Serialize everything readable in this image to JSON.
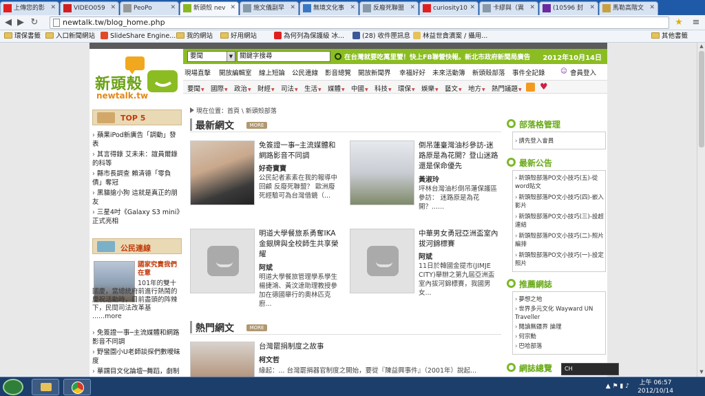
{
  "browser": {
    "tabs": [
      {
        "label": "上傳您的影",
        "color": "#e02020"
      },
      {
        "label": "VIDEO059",
        "color": "#d02020"
      },
      {
        "label": "PeoPo",
        "color": "#999999"
      },
      {
        "label": "新頭殼 nev",
        "color": "#8ab822"
      },
      {
        "label": "施文儀副早",
        "color": "#8899aa"
      },
      {
        "label": "無境文化事",
        "color": "#3b78c4"
      },
      {
        "label": "反廢死聯盟",
        "color": "#8899aa"
      },
      {
        "label": "curiosity10",
        "color": "#e02020"
      },
      {
        "label": "卡繆與（異",
        "color": "#8899aa"
      },
      {
        "label": "(10596 封",
        "color": "#6a2aa0"
      },
      {
        "label": "馬勒高階文",
        "color": "#c8a040"
      }
    ],
    "url": "newtalk.tw/blog_home.php",
    "bookmarks": [
      {
        "label": "環保書籤",
        "type": "folder"
      },
      {
        "label": "入口新聞網站",
        "type": "folder"
      },
      {
        "label": "SlideShare Engine...",
        "type": "slideshare"
      },
      {
        "label": "我的網站",
        "type": "folder"
      },
      {
        "label": "好用網站",
        "type": "folder"
      },
      {
        "label": "為何列為保護級 冰...",
        "type": "youtube"
      },
      {
        "label": "(28) 收件匣訊息",
        "type": "facebook"
      },
      {
        "label": "林益世貪瀆案 / 攝用...",
        "type": "doc"
      },
      {
        "label": "其他書籤",
        "type": "folder"
      }
    ]
  },
  "site": {
    "logo_text": "新頭殼",
    "logo_sub": "newtalk.tw",
    "search_select": "要聞",
    "search_placeholder": "關鍵字搜尋",
    "ticker": "在台灣就要吃萬里蟹！快上FB聯營快報。新北市政府新聞局廣告",
    "date": "2012年10月14日",
    "nav1": [
      "現場直擊",
      "開放編輯室",
      "線上短論",
      "公民連線",
      "影音總覽",
      "開放新聞界",
      "幸福好好",
      "未來活動簿",
      "新頭殼部落",
      "事件全記錄",
      "會員登入"
    ],
    "nav2": [
      "要聞",
      "國際",
      "政治",
      "財經",
      "司法",
      "生活",
      "媒體",
      "中國",
      "科技",
      "環保",
      "娛樂",
      "藝文",
      "地方",
      "熱門議題"
    ],
    "breadcrumb": "現在位置：首頁 \\ 新頭殼部落"
  },
  "left": {
    "top5_title": "TOP 5",
    "top5": [
      "蘋果iPod新廣告「調動」發表",
      "其言得錄 艾未未：誼員爾錄的科等",
      "縣市長調查 賴清德「零負債」奪冠",
      "黑貓搶小狗 這就是真正的朋友",
      "三星4吋《Galaxy S3 mini》正式亮相"
    ],
    "civic_title": "公民連線",
    "civic_story_title": "國家究責我們在意",
    "civic_story_text": "101年的雙十國慶，當總統府前進行熱鬧的慶祝活動時，目前盡頭的阵辣下，民間司法改革基 ......more",
    "civic_items": [
      "免簽證一事─主流媒體和網路影音不同調",
      "野蠻園小U老師談探們數曖昧度",
      "華謂目文化論壇─舞蹈，劇制"
    ]
  },
  "main": {
    "latest_title": "最新網文",
    "more": "MORE",
    "articles": [
      {
        "title": "免簽證一事─主流媒體和網路影音不同調",
        "author": "好奇寶寶",
        "summary": "公民記者素素在我的報導中回顧 反廢死聯盟？ 歐洲廢死經驗可為台灣借鏡（..."
      },
      {
        "title": "倒吊蓮臺灣油杉參訪-迷路原是為花開？登山迷路還是保命優先",
        "author": "黃淑玲",
        "summary": "坪林台灣油杉倒吊蓮保護區參訪： 迷路原是為花開？......"
      },
      {
        "title": "明道大學餐旅系勇奪IKA金銀牌與全校師生共享榮耀",
        "author": "阿斌",
        "summary": "明道大學餐旅管理學系學生楊捷鴻、黃汶達助理教授參加在德國舉行的奧林匹克廚..."
      },
      {
        "title": "中華男女勇冠亞洲盃室內拔河錦標賽",
        "author": "阿斌",
        "summary": "11日於韓國金提市(JIMJE CITY)舉辦之第九屆亞洲盃室內拔河錦標賽，我國男女..."
      }
    ],
    "hot_title": "熱門網文",
    "hot_articles": [
      {
        "title": "台灣罷捐制度之故事",
        "author": "柯文哲",
        "summary": "緣起：... 台灣罷捐器官制度之開始，要從『陳益興事件』（2001年）說起..."
      }
    ]
  },
  "right": {
    "blog_admin_title": "部落格管理",
    "blog_admin_item": "請先登入會員",
    "notice_title": "最新公告",
    "notices": [
      "新頭殼部落PO文小技巧(五)-從word貼文",
      "新頭殼部落PO文小技巧(四)-嵌入影片",
      "新頭殼部落PO文小技巧(三)-設超連結",
      "新頭殼部落PO文小技巧(二)-照片編排",
      "新頭殼部落PO文小技巧(一)-設定照片"
    ],
    "recommend_title": "推薦網誌",
    "recommends": [
      "夢想之地",
      "世界多元文化 Wayward UN Traveller",
      "閱讀無疆界 論理",
      "何宗勳",
      "巴哈部落"
    ],
    "overview_title": "網誌總覽"
  },
  "taskbar": {
    "time": "上午 06:57",
    "date": "2012/10/14",
    "ime": "CH"
  },
  "colors": {
    "brand_green": "#8bbd22",
    "tab_active": "#f4f7fb",
    "taskbar": "#1c3e6b"
  }
}
